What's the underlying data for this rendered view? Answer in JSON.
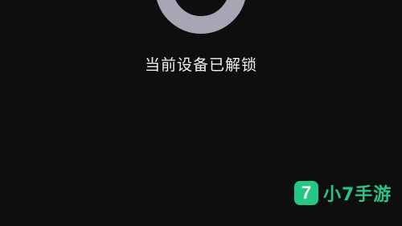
{
  "lock_screen": {
    "icon": "unlocked-ring-icon",
    "status_text": "当前设备已解锁",
    "ring_color": "#a7a6b4",
    "background_color": "#0e0e0f"
  },
  "watermark": {
    "logo_glyph": "7",
    "text": "小7手游",
    "brand_color": "#25c786"
  }
}
